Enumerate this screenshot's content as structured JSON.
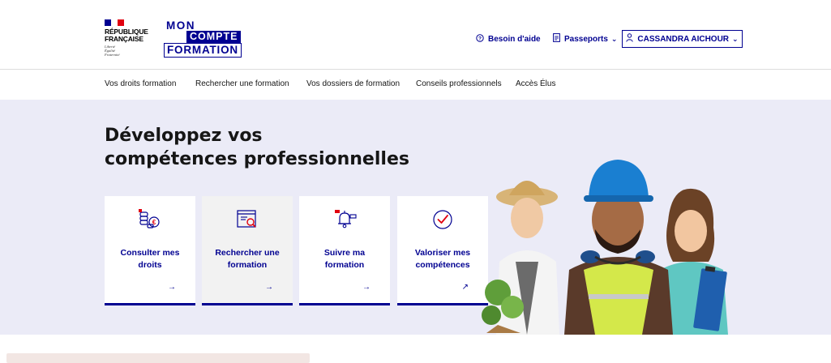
{
  "header": {
    "gov": {
      "lines": [
        "RÉPUBLIQUE",
        "FRANÇAISE"
      ],
      "motto": [
        "Liberté",
        "Égalité",
        "Fraternité"
      ],
      "flag_colors": [
        "#000091",
        "#ffffff",
        "#e1000f"
      ]
    },
    "logo": {
      "line1": "MON",
      "line2": "COMPTE",
      "line3": "FORMATION"
    },
    "tools": {
      "help_label": "Besoin d'aide",
      "help_icon": "question-circle-icon",
      "passports_label": "Passeports",
      "passports_icon": "document-icon"
    },
    "user": {
      "name": "CASSANDRA AICHOUR",
      "icon": "user-icon"
    }
  },
  "nav": {
    "items": [
      "Vos droits formation",
      "Rechercher une formation",
      "Vos dossiers de formation",
      "Conseils professionnels",
      "Accès Élus"
    ]
  },
  "hero": {
    "title_line1": "Développez vos",
    "title_line2": "compétences professionnelles",
    "cards": [
      {
        "label": "Consulter mes droits",
        "icon": "coins-euro-icon",
        "arrow": "→"
      },
      {
        "label": "Rechercher une formation",
        "icon": "search-window-icon",
        "arrow": "→"
      },
      {
        "label": "Suivre ma formation",
        "icon": "notification-bell-icon",
        "arrow": "→"
      },
      {
        "label": "Valoriser mes compétences",
        "icon": "check-circle-icon",
        "arrow": "↗"
      }
    ]
  },
  "colors": {
    "primary": "#000091",
    "hero_bg": "#ebebf7",
    "accent_red": "#e1000f"
  }
}
